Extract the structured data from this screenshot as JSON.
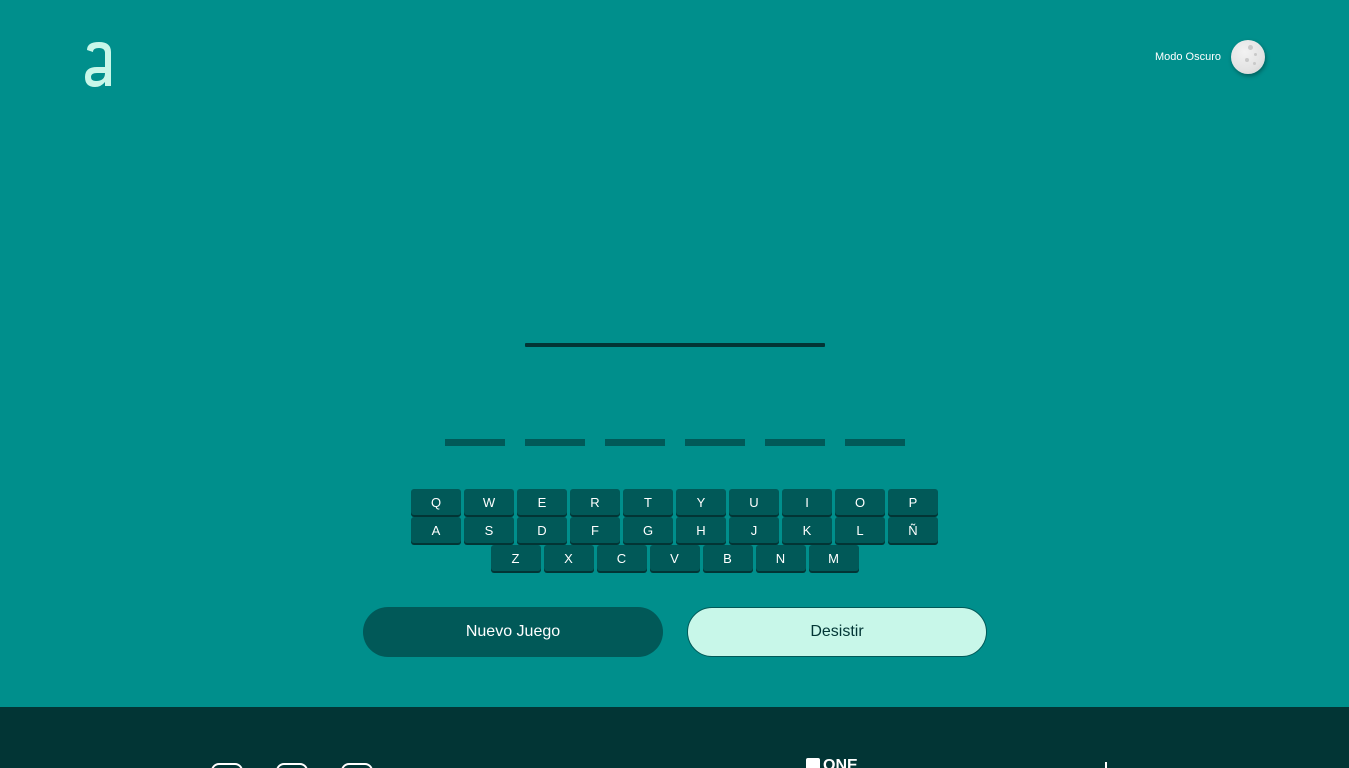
{
  "brand": {
    "logo_icon": "alura-a-logo",
    "accent_color": "#008f8c"
  },
  "header": {
    "dark_mode_label": "Modo Oscuro",
    "dark_mode_icon": "moon-icon"
  },
  "game": {
    "word_length": 6,
    "keyboard": {
      "rows": [
        [
          "Q",
          "W",
          "E",
          "R",
          "T",
          "Y",
          "U",
          "I",
          "O",
          "P"
        ],
        [
          "A",
          "S",
          "D",
          "F",
          "G",
          "H",
          "J",
          "K",
          "L",
          "Ñ"
        ],
        [
          "Z",
          "X",
          "C",
          "V",
          "B",
          "N",
          "M"
        ]
      ]
    },
    "buttons": {
      "new_game": "Nuevo Juego",
      "give_up": "Desistir"
    }
  },
  "footer": {
    "one_logo_text": "ONE",
    "icons": [
      "linkedin-icon",
      "github-icon",
      "portfolio-icon"
    ]
  },
  "colors": {
    "background": "#008f8c",
    "dark": "#015958",
    "darkest": "#023535",
    "light": "#c8f7e9"
  }
}
